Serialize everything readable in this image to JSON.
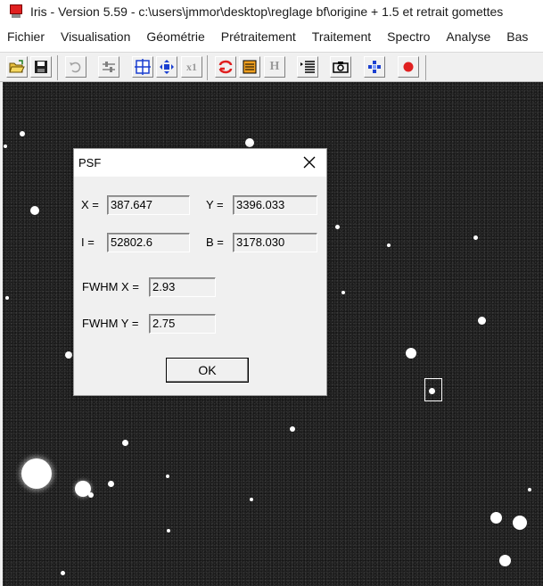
{
  "window": {
    "title": "Iris - Version 5.59 - c:\\users\\jmmor\\desktop\\reglage bf\\origine + 1.5 et retrait gomettes"
  },
  "menu": [
    "Fichier",
    "Visualisation",
    "Géométrie",
    "Prétraitement",
    "Traitement",
    "Spectro",
    "Analyse",
    "Bas"
  ],
  "toolbar": {
    "buttons": [
      {
        "icon": "open-folder-icon"
      },
      {
        "icon": "save-icon"
      },
      {
        "icon": "undo-icon"
      },
      {
        "icon": "threshold-sliders-icon"
      },
      {
        "icon": "zoom-target-icon"
      },
      {
        "icon": "move-arrows-icon"
      },
      {
        "icon": "zoom-x1-icon",
        "label": "x1"
      },
      {
        "icon": "red-swirl-icon"
      },
      {
        "icon": "orange-panel-icon"
      },
      {
        "icon": "header-icon",
        "label": "H"
      },
      {
        "icon": "list-icon"
      },
      {
        "icon": "camera-icon"
      },
      {
        "icon": "blue-diamond-icon"
      },
      {
        "icon": "red-dot-icon"
      }
    ]
  },
  "dialog": {
    "title": "PSF",
    "x_label": "X =",
    "x_value": "387.647",
    "y_label": "Y =",
    "y_value": "3396.033",
    "i_label": "I =",
    "i_value": "52802.6",
    "b_label": "B =",
    "b_value": "3178.030",
    "fwhm_x_label": "FWHM X =",
    "fwhm_x_value": "2.93",
    "fwhm_y_label": "FWHM Y =",
    "fwhm_y_value": "2.75",
    "ok_label": "OK"
  },
  "colors": {
    "toolbar_bg": "#f0f0f0",
    "image_bg": "#222222",
    "accent_red": "#e02020",
    "accent_blue": "#1a3fd0"
  }
}
